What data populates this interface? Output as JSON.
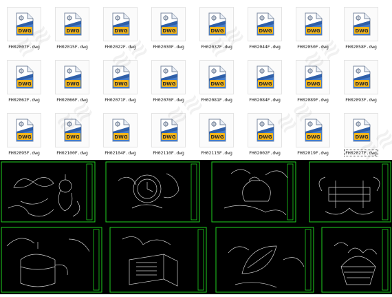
{
  "files": [
    {
      "name": "FH02007F.dwg",
      "badge": "DWG"
    },
    {
      "name": "FH02015F.dwg",
      "badge": "DWG"
    },
    {
      "name": "FH02022F.dwg",
      "badge": "DWG"
    },
    {
      "name": "FH02030F.dwg",
      "badge": "DWG"
    },
    {
      "name": "FH02037F.dwg",
      "badge": "DWG"
    },
    {
      "name": "FH02044F.dwg",
      "badge": "DWG"
    },
    {
      "name": "FH02050F.dwg",
      "badge": "DWG"
    },
    {
      "name": "FH02058F.dwg",
      "badge": "DWG"
    },
    {
      "name": "FH02062F.dwg",
      "badge": "DWG"
    },
    {
      "name": "FH02066F.dwg",
      "badge": "DWG"
    },
    {
      "name": "FH02071F.dwg",
      "badge": "DWG"
    },
    {
      "name": "FH02076F.dwg",
      "badge": "DWG"
    },
    {
      "name": "FH02081F.dwg",
      "badge": "DWG"
    },
    {
      "name": "FH02084F.dwg",
      "badge": "DWG"
    },
    {
      "name": "FH02089F.dwg",
      "badge": "DWG"
    },
    {
      "name": "FH02093F.dwg",
      "badge": "DWG"
    },
    {
      "name": "FH02095F.dwg",
      "badge": "DWG"
    },
    {
      "name": "FH02100F.dwg",
      "badge": "DWG"
    },
    {
      "name": "FH02104F.dwg",
      "badge": "DWG"
    },
    {
      "name": "FH02110F.dwg",
      "badge": "DWG"
    },
    {
      "name": "FH02115F.dwg",
      "badge": "DWG"
    },
    {
      "name": "FH02002F.dwg",
      "badge": "DWG"
    },
    {
      "name": "FH02019F.dwg",
      "badge": "DWG"
    },
    {
      "name": "FH02027F.dwg",
      "badge": "DWG",
      "selected": true
    }
  ],
  "colors": {
    "cad_background": "#000000",
    "cad_line": "#cfcfcf",
    "cad_frame": "#1fd21f",
    "icon_gold": "#f3b51a",
    "icon_blue": "#2f5fa8"
  },
  "drawings": [
    {
      "icon": "butterfly-flower-motif"
    },
    {
      "icon": "clock-cloud-motif"
    },
    {
      "icon": "vase-cloud-motif"
    },
    {
      "icon": "endless-knot-motif"
    },
    {
      "icon": "teapot-cloud-motif"
    },
    {
      "icon": "scroll-book-motif"
    },
    {
      "icon": "leaf-cloud-motif"
    },
    {
      "icon": "flower-basket-motif"
    }
  ]
}
